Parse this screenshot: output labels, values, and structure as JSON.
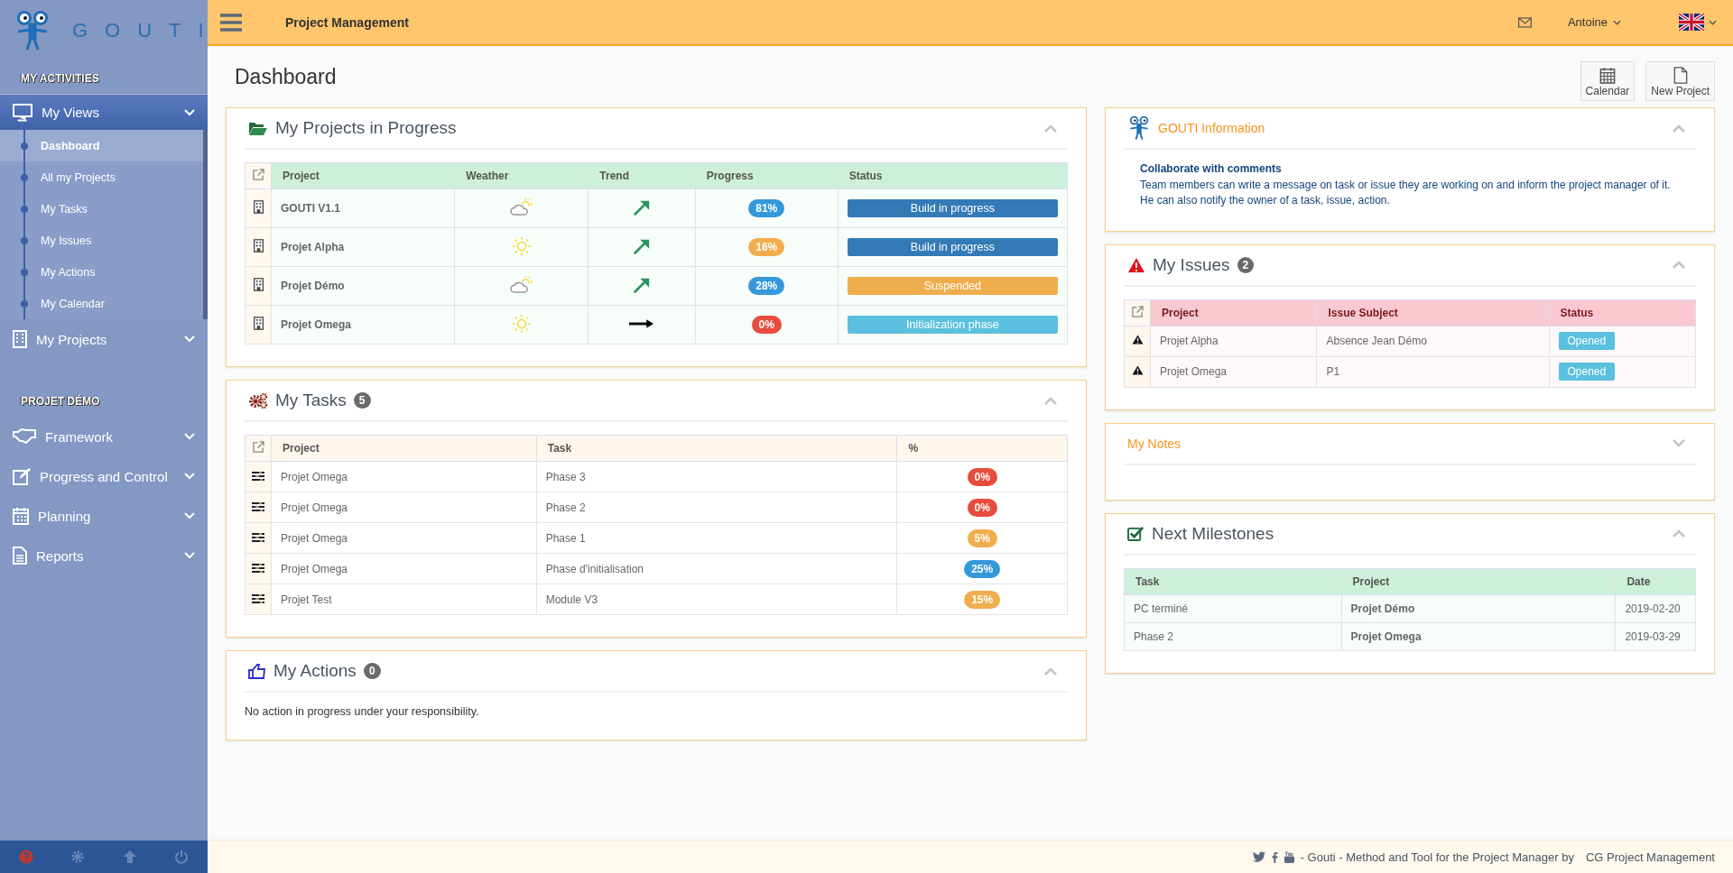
{
  "brand": {
    "name": "GOUTI"
  },
  "sidebar": {
    "sections": [
      {
        "title": "MY ACTIVITIES",
        "items": [
          {
            "label": "My Views",
            "expanded": true,
            "children": [
              {
                "label": "Dashboard",
                "selected": true
              },
              {
                "label": "All my Projects",
                "selected": false
              },
              {
                "label": "My Tasks",
                "selected": false
              },
              {
                "label": "My Issues",
                "selected": false
              },
              {
                "label": "My Actions",
                "selected": false
              },
              {
                "label": "My Calendar",
                "selected": false
              }
            ]
          },
          {
            "label": "My Projects",
            "expanded": false
          }
        ]
      },
      {
        "title": "PROJET DÉMO",
        "items": [
          {
            "label": "Framework",
            "expanded": false
          },
          {
            "label": "Progress and Control",
            "expanded": false
          },
          {
            "label": "Planning",
            "expanded": false
          },
          {
            "label": "Reports",
            "expanded": false
          }
        ]
      }
    ]
  },
  "topbar": {
    "title": "Project Management",
    "user": "Antoine"
  },
  "page": {
    "title": "Dashboard",
    "actions": [
      "Calendar",
      "New Project"
    ]
  },
  "projects": {
    "title": "My Projects in Progress",
    "collapsed": false,
    "columns": [
      "Project",
      "Weather",
      "Trend",
      "Progress",
      "Status"
    ],
    "rows": [
      {
        "project": "GOUTI V1.1",
        "weather": {
          "kind": "sun-cloud"
        },
        "trend": {
          "kind": "up"
        },
        "progress": {
          "text": "81%",
          "color": "#3498db"
        },
        "status": {
          "text": "Build in progress",
          "color": "#337ab7"
        }
      },
      {
        "project": "Projet Alpha",
        "weather": {
          "kind": "sun"
        },
        "trend": {
          "kind": "up"
        },
        "progress": {
          "text": "16%",
          "color": "#f0ad4e"
        },
        "status": {
          "text": "Build in progress",
          "color": "#337ab7"
        }
      },
      {
        "project": "Projet Démo",
        "weather": {
          "kind": "sun-cloud"
        },
        "trend": {
          "kind": "up"
        },
        "progress": {
          "text": "28%",
          "color": "#3498db"
        },
        "status": {
          "text": "Suspended",
          "color": "#f0ad4e"
        }
      },
      {
        "project": "Projet Omega",
        "weather": {
          "kind": "sun"
        },
        "trend": {
          "kind": "flat"
        },
        "progress": {
          "text": "0%",
          "color": "#e74c3c"
        },
        "status": {
          "text": "Initialization phase",
          "color": "#5bc0de"
        }
      }
    ]
  },
  "tasks": {
    "title": "My Tasks",
    "count": "5",
    "collapsed": false,
    "columns": [
      "Project",
      "Task",
      "%"
    ],
    "rows": [
      {
        "project": "Projet Omega",
        "task": "Phase 3",
        "percent": "0%",
        "color": "#e74c3c"
      },
      {
        "project": "Projet Omega",
        "task": "Phase 2",
        "percent": "0%",
        "color": "#e74c3c"
      },
      {
        "project": "Projet Omega",
        "task": "Phase 1",
        "percent": "5%",
        "color": "#f0ad4e"
      },
      {
        "project": "Projet Omega",
        "task": "Phase d'initialisation",
        "percent": "25%",
        "color": "#3498db"
      },
      {
        "project": "Projet Test",
        "task": "Module V3",
        "percent": "15%",
        "color": "#f0ad4e"
      }
    ]
  },
  "actions": {
    "title": "My Actions",
    "count": "0",
    "collapsed": false,
    "message": "No action in progress under your responsibility."
  },
  "info": {
    "title": "GOUTI Information",
    "collapsed": false,
    "heading": "Collaborate with comments",
    "text": "Team members can write a message on task or issue they are working on and inform the project manager of it. He can also notify the owner of a task, issue, action."
  },
  "issues": {
    "title": "My Issues",
    "count": "2",
    "collapsed": false,
    "columns": [
      "Project",
      "Issue Subject",
      "Status"
    ],
    "rows": [
      {
        "project": "Projet Alpha",
        "subject": "Absence Jean Démo",
        "status": "Opened"
      },
      {
        "project": "Projet Omega",
        "subject": "P1",
        "status": "Opened"
      }
    ]
  },
  "notes": {
    "title": "My Notes",
    "collapsed": true
  },
  "milestones": {
    "title": "Next Milestones",
    "collapsed": false,
    "columns": [
      "Task",
      "Project",
      "Date"
    ],
    "rows": [
      {
        "task": "PC terminé",
        "project": "Projet Démo",
        "date": "2019-02-20"
      },
      {
        "task": "Phase 2",
        "project": "Projet Omega",
        "date": "2019-03-29"
      }
    ]
  },
  "footer": {
    "text": "- Gouti - Method and Tool for the Project Manager by",
    "link": "CG Project Management"
  }
}
